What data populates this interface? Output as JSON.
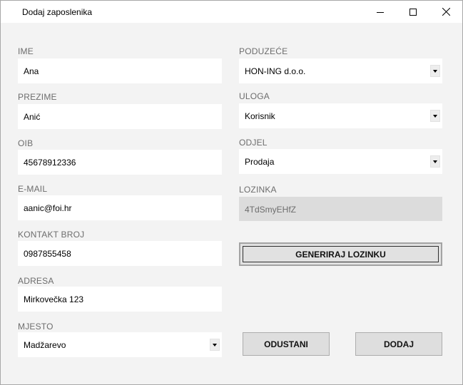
{
  "window": {
    "title": "Dodaj zaposlenika"
  },
  "left": {
    "ime": {
      "label": "IME",
      "value": "Ana"
    },
    "prezime": {
      "label": "PREZIME",
      "value": "Anić"
    },
    "oib": {
      "label": "OIB",
      "value": "45678912336"
    },
    "email": {
      "label": "E-MAIL",
      "value": "aanic@foi.hr"
    },
    "kontakt": {
      "label": "KONTAKT BROJ",
      "value": "0987855458"
    },
    "adresa": {
      "label": "ADRESA",
      "value": "Mirkovečka 123"
    },
    "mjesto": {
      "label": "MJESTO",
      "value": "Madžarevo"
    }
  },
  "right": {
    "poduzece": {
      "label": "PODUZEĆE",
      "value": "HON-ING d.o.o."
    },
    "uloga": {
      "label": "ULOGA",
      "value": "Korisnik"
    },
    "odjel": {
      "label": "ODJEL",
      "value": "Prodaja"
    },
    "lozinka": {
      "label": "LOZINKA",
      "value": "4TdSmyEHfZ"
    }
  },
  "buttons": {
    "generate": "GENERIRAJ LOZINKU",
    "cancel": "ODUSTANI",
    "add": "DODAJ"
  }
}
